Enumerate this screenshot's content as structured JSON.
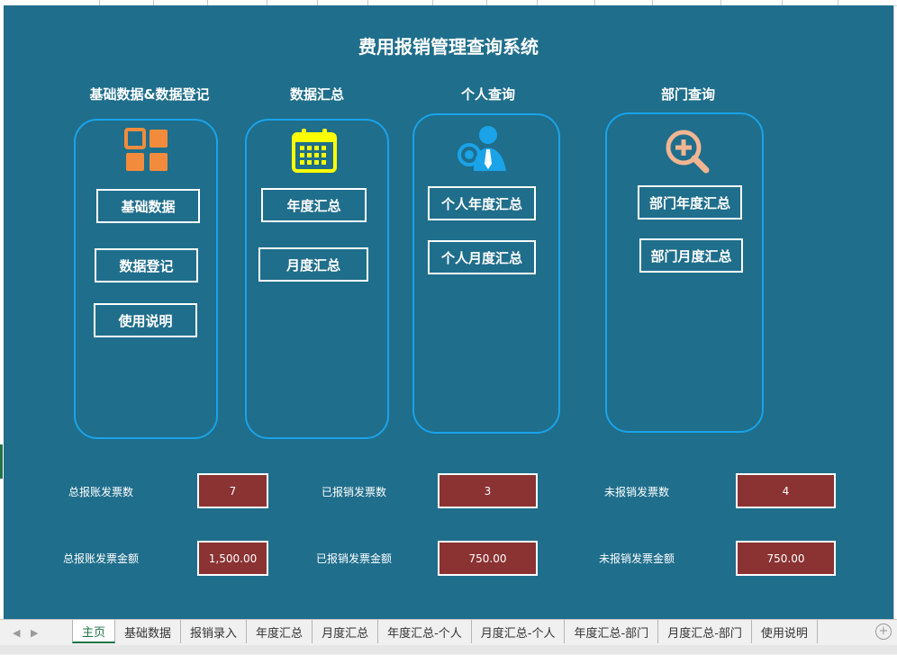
{
  "title": "费用报销管理查询系统",
  "sections": {
    "basic": {
      "header": "基础数据&数据登记",
      "buttons": [
        "基础数据",
        "数据登记",
        "使用说明"
      ],
      "icon": "grid-apps-icon"
    },
    "summary": {
      "header": "数据汇总",
      "buttons": [
        "年度汇总",
        "月度汇总"
      ],
      "icon": "calendar-icon"
    },
    "personal": {
      "header": "个人查询",
      "buttons": [
        "个人年度汇总",
        "个人月度汇总"
      ],
      "icon": "person-search-icon"
    },
    "department": {
      "header": "部门查询",
      "buttons": [
        "部门年度汇总",
        "部门月度汇总"
      ],
      "icon": "zoom-in-icon"
    }
  },
  "stats": {
    "total_count_label": "总报账发票数",
    "total_count": "7",
    "reimbursed_count_label": "已报销发票数",
    "reimbursed_count": "3",
    "unreimbursed_count_label": "未报销发票数",
    "unreimbursed_count": "4",
    "total_amount_label": "总报账发票金额",
    "total_amount": "1,500.00",
    "reimbursed_amount_label": "已报销发票金额",
    "reimbursed_amount": "750.00",
    "unreimbursed_amount_label": "未报销发票金额",
    "unreimbursed_amount": "750.00"
  },
  "sheet_tabs": [
    "主页",
    "基础数据",
    "报销录入",
    "年度汇总",
    "月度汇总",
    "年度汇总-个人",
    "月度汇总-个人",
    "年度汇总-部门",
    "月度汇总-部门",
    "使用说明"
  ],
  "active_tab": "主页",
  "colors": {
    "background": "#1f6e8c",
    "panel_border": "#1aa3e8",
    "stat_box": "#8b3232",
    "grid_icon": "#f28c3c",
    "calendar_icon": "#ffff00",
    "person_icon": "#1aa3e8",
    "zoom_icon": "#f2b592"
  }
}
